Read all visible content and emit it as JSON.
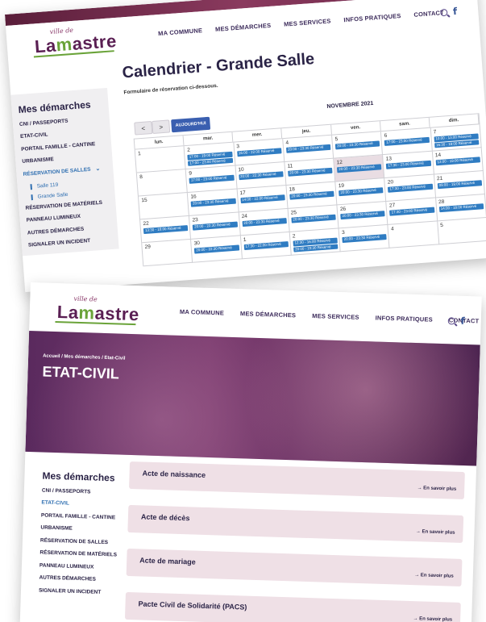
{
  "brand": {
    "small": "ville de",
    "main_a": "La",
    "main_m": "m",
    "main_b": "astre"
  },
  "nav": [
    "MA COMMUNE",
    "MES DÉMARCHES",
    "MES SERVICES",
    "INFOS PRATIQUES",
    "CONTACT"
  ],
  "facebook_glyph": "f",
  "screen1": {
    "title": "Calendrier - Grande Salle",
    "subtitle": "Formulaire de réservation ci-dessous.",
    "prev": "<",
    "next": ">",
    "today": "AUJOURD'HUI",
    "month": "NOVEMBRE 2021",
    "days": [
      "lun.",
      "mar.",
      "mer.",
      "jeu.",
      "ven.",
      "sam.",
      "dim."
    ],
    "sidebar": {
      "title": "Mes démarches",
      "items": [
        "CNI / PASSEPORTS",
        "ETAT-CIVIL",
        "PORTAIL FAMILLE - CANTINE",
        "URBANISME"
      ],
      "active": "RÉSERVATION DE SALLES",
      "subitems": [
        "Salle 119",
        "Grande Salle"
      ],
      "items_after": [
        "RÉSERVATION DE MATÉRIELS",
        "PANNEAU LUMINEUX",
        "AUTRES DÉMARCHES",
        "SIGNALER UN INCIDENT"
      ]
    },
    "weeks": [
      [
        {
          "n": "1",
          "e": []
        },
        {
          "n": "2",
          "e": [
            "17:00 - 19:00 Réservé",
            "17:00 - 23:00 Réservé"
          ]
        },
        {
          "n": "3",
          "e": [
            "16:00 - 22:00 Réservé"
          ]
        },
        {
          "n": "4",
          "e": [
            "20:00 - 23:30 Réservé"
          ]
        },
        {
          "n": "5",
          "e": [
            "20:00 - 23:30 Réservé"
          ]
        },
        {
          "n": "6",
          "e": [
            "17:00 - 23:00 Réservé"
          ]
        },
        {
          "n": "7",
          "e": [
            "10:00 - 13:00 Réservé",
            "16:30 - 19:00 Réservé"
          ]
        }
      ],
      [
        {
          "n": "8",
          "e": []
        },
        {
          "n": "9",
          "e": [
            "17:00 - 23:00 Réservé"
          ]
        },
        {
          "n": "10",
          "e": [
            "20:00 - 22:30 Réservé"
          ]
        },
        {
          "n": "11",
          "e": [
            "20:00 - 23:30 Réservé"
          ]
        },
        {
          "n": "12",
          "e": [
            "20:00 - 23:30 Réservé"
          ],
          "hl": true
        },
        {
          "n": "13",
          "e": [
            "17:30 - 23:00 Réservé"
          ]
        },
        {
          "n": "14",
          "e": [
            "13:00 - 19:00 Réservé"
          ]
        }
      ],
      [
        {
          "n": "15",
          "e": []
        },
        {
          "n": "16",
          "e": [
            "20:00 - 23:30 Réservé"
          ]
        },
        {
          "n": "17",
          "e": [
            "14:00 - 22:00 Réservé"
          ]
        },
        {
          "n": "18",
          "e": [
            "20:00 - 23:30 Réservé"
          ]
        },
        {
          "n": "19",
          "e": [
            "20:00 - 23:30 Réservé"
          ]
        },
        {
          "n": "20",
          "e": [
            "17:30 - 23:00 Réservé"
          ]
        },
        {
          "n": "21",
          "e": [
            "09:00 - 19:00 Réservé"
          ]
        }
      ],
      [
        {
          "n": "22",
          "e": [
            "13:30 - 16:00 Réservé"
          ]
        },
        {
          "n": "23",
          "e": [
            "20:00 - 22:30 Réservé"
          ]
        },
        {
          "n": "24",
          "e": [
            "20:00 - 23:30 Réservé"
          ]
        },
        {
          "n": "25",
          "e": [
            "20:00 - 23:30 Réservé"
          ]
        },
        {
          "n": "26",
          "e": [
            "20:00 - 23:30 Réservé"
          ]
        },
        {
          "n": "27",
          "e": [
            "17:30 - 23:00 Réservé"
          ]
        },
        {
          "n": "28",
          "e": [
            "14:00 - 18:00 Réservé"
          ]
        }
      ],
      [
        {
          "n": "29",
          "e": []
        },
        {
          "n": "30",
          "e": [
            "20:00 - 22:30 Réservé"
          ]
        },
        {
          "n": "1",
          "e": [
            "17:30 - 22:00 Réservé"
          ]
        },
        {
          "n": "2",
          "e": [
            "12:30 - 16:00 Réservé",
            "20:00 - 23:30 Réservé"
          ]
        },
        {
          "n": "3",
          "e": [
            "20:00 - 23:30 Réservé"
          ]
        },
        {
          "n": "4",
          "e": []
        },
        {
          "n": "5",
          "e": []
        }
      ]
    ]
  },
  "screen2": {
    "breadcrumb": "Accueil / Mes démarches / Etat-Civil",
    "title": "ETAT-CIVIL",
    "sidebar": {
      "title": "Mes démarches",
      "items": [
        "CNI / PASSEPORTS",
        "ETAT-CIVIL",
        "PORTAIL FAMILLE - CANTINE",
        "URBANISME",
        "RÉSERVATION DE SALLES",
        "RÉSERVATION DE MATÉRIELS",
        "PANNEAU LUMINEUX",
        "AUTRES DÉMARCHES",
        "SIGNALER UN INCIDENT"
      ],
      "active_index": 1
    },
    "cards": [
      "Acte de naissance",
      "Acte de décès",
      "Acte de mariage",
      "Pacte Civil de Solidarité (PACS)"
    ],
    "card_link": "→ En savoir plus"
  }
}
